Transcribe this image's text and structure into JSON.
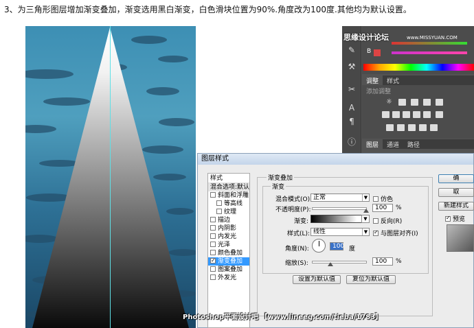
{
  "caption": "3、为三角形图层增加渐变叠加，渐变选用黑白渐变，白色滑块位置为90%.角度改为100度.其他均为默认设置。",
  "watermark_top": "思缘设计论坛",
  "watermark_top_url": "www.MISSYUAN.COM",
  "watermark_bottom": "Photoshop平面设计吧 【www.lineeg.com/tieba/1783】",
  "right_panel": {
    "color_labels": [
      "B"
    ],
    "adjust_tabs": [
      "调整",
      "样式"
    ],
    "adjust_title": "添加调整",
    "layer_tabs": [
      "图层",
      "通道",
      "路径"
    ]
  },
  "dialog": {
    "title": "图层样式",
    "styles_header": "样式",
    "blend_default": "混合选项:默认",
    "style_items": [
      {
        "label": "斜面和浮雕",
        "checked": false,
        "sub": false
      },
      {
        "label": "等高线",
        "checked": false,
        "sub": true
      },
      {
        "label": "纹理",
        "checked": false,
        "sub": true
      },
      {
        "label": "描边",
        "checked": false,
        "sub": false
      },
      {
        "label": "内阴影",
        "checked": false,
        "sub": false
      },
      {
        "label": "内发光",
        "checked": false,
        "sub": false
      },
      {
        "label": "光泽",
        "checked": false,
        "sub": false
      },
      {
        "label": "颜色叠加",
        "checked": false,
        "sub": false
      },
      {
        "label": "渐变叠加",
        "checked": true,
        "sub": false,
        "selected": true
      },
      {
        "label": "图案叠加",
        "checked": false,
        "sub": false
      },
      {
        "label": "外发光",
        "checked": false,
        "sub": false
      }
    ],
    "section_title": "渐变叠加",
    "subsection_title": "渐变",
    "blend_mode_label": "混合模式(O):",
    "blend_mode_value": "正常",
    "dither_label": "仿色",
    "opacity_label": "不透明度(P):",
    "opacity_value": "100",
    "opacity_fraction": 1.0,
    "percent": "%",
    "gradient_label": "渐变:",
    "reverse_label": "反向(R)",
    "style_label": "样式(L):",
    "style_value": "线性",
    "align_label": "与图层对齐(I)",
    "angle_label": "角度(N):",
    "angle_value": "100",
    "degree": "度",
    "scale_label": "缩放(S):",
    "scale_value": "100",
    "scale_fraction": 0.33,
    "btn_set_default": "设置为默认值",
    "btn_reset_default": "复位为默认值",
    "btn_ok": "确",
    "btn_cancel": "取",
    "btn_new_style": "新建样式",
    "preview_label": "预览"
  }
}
